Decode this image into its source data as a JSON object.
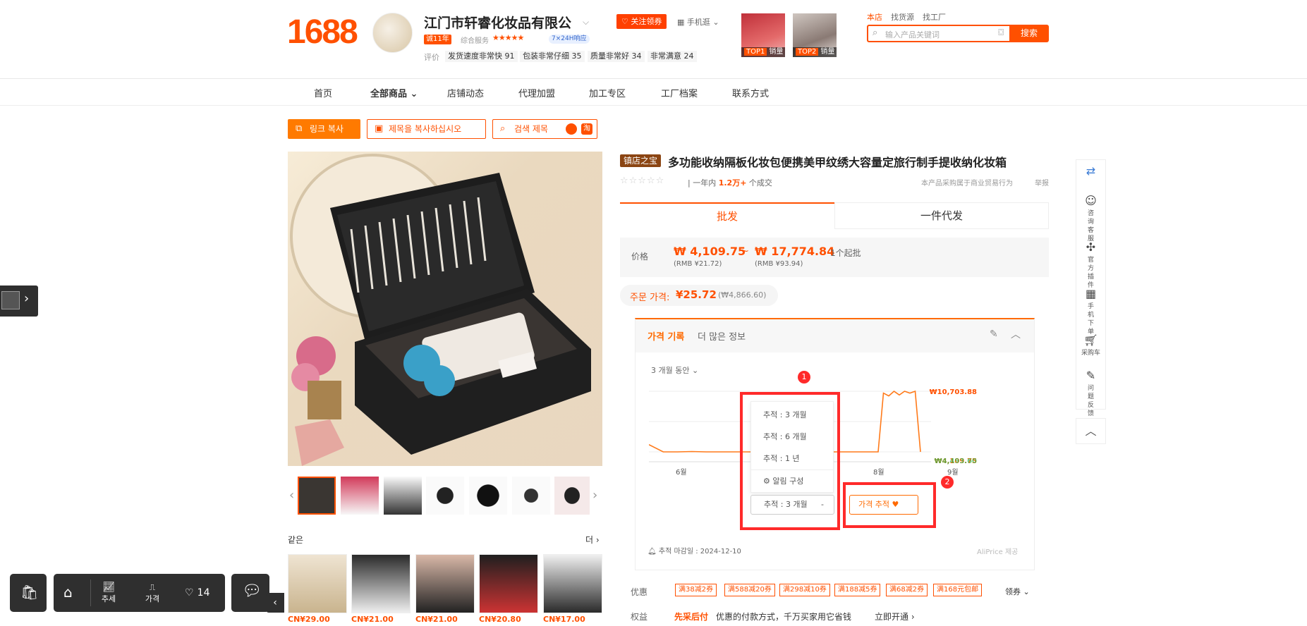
{
  "header": {
    "logo": "1688",
    "shop_name": "江门市轩睿化妆品有限公",
    "follow_label": "关注领券",
    "mobile_label": "手机逛",
    "years_badge": "诚11年",
    "service_label": "综合服务",
    "service_tag": "7×24H响应",
    "eval_label": "评价",
    "eval_items": [
      "发货速度非常快 91",
      "包装非常仔细 35",
      "质量非常好 34",
      "非常满意 24"
    ],
    "top_items": [
      {
        "rank": "TOP1",
        "label": "销量"
      },
      {
        "rank": "TOP2",
        "label": "销量"
      }
    ],
    "search_tabs": [
      "本店",
      "找货源",
      "找工厂"
    ],
    "search_placeholder": "输入产品关键词",
    "search_button": "搜索"
  },
  "nav": {
    "items": [
      "首页",
      "全部商品",
      "店铺动态",
      "代理加盟",
      "加工专区",
      "工厂档案",
      "联系方式"
    ]
  },
  "actions": {
    "copy_link": "링크 복사",
    "copy_title": "제목을 복사하십시오",
    "search_title": "검색 제목"
  },
  "gallery": {
    "same_label": "같은",
    "more_label": "더",
    "similar_prices": [
      "CN¥29.00",
      "CN¥21.00",
      "CN¥21.00",
      "CN¥20.80",
      "CN¥17.00"
    ]
  },
  "product": {
    "shop_tag": "镇店之宝",
    "title": "多功能收纳隔板化妆包便携美甲纹绣大容量定旅行制手提收纳化妆箱",
    "sales_prefix": "一年内",
    "sales_value": "1.2万+",
    "sales_suffix": "个成交",
    "notice": "本产品采购属于商业贸易行为",
    "report": "举报",
    "tab_wholesale": "批发",
    "tab_dropship": "一件代发",
    "price_label": "价格",
    "price_low": "₩ 4,109.75",
    "price_sep": "~",
    "price_high": "₩ 17,774.84",
    "moq": "1个起批",
    "rmb_low": "(RMB ¥21.72)",
    "rmb_high": "(RMB ¥93.94)",
    "order_label": "주문 가격:",
    "order_value": "¥25.72",
    "order_won": "(₩4,866.60)"
  },
  "tracker": {
    "tab_history": "가격 기록",
    "tab_more": "더 많은 정보",
    "period": "3 개월 동안",
    "menu_items": [
      "추적 : 3 개월",
      "추적 : 6 개월",
      "추적 : 1 년"
    ],
    "alert_config": "알림 구성",
    "selected": "추적 : 3 개월",
    "selected_suffix": "-",
    "track_button": "가격 추적",
    "deadline": "추적 마감일 : 2024-12-10",
    "powered": "AliPrice 제공",
    "callout_1": "1",
    "callout_2": "2",
    "accent_color": "#ff6a00",
    "highlight_color": "#ff2a2a"
  },
  "chart_data": {
    "type": "line",
    "x_ticks": [
      "6월",
      "8월",
      "9월"
    ],
    "max_label": "₩10,703.88",
    "current_label_a": "₩4,109.75",
    "current_label_b": "₩4,493.60",
    "series": [
      {
        "values": [
          4900,
          4109,
          4109,
          4150,
          4109,
          4109,
          4109,
          4109,
          4109,
          4109,
          4109,
          4109,
          4109,
          4109,
          4109,
          4109,
          4109,
          10500,
          10200,
          10703,
          10300,
          10703,
          10500,
          10703,
          4109
        ]
      }
    ]
  },
  "promo": {
    "label": "优惠",
    "coupons": [
      "满38减2券",
      "满588减20券",
      "满298减10券",
      "满188减5券",
      "满68减2券",
      "满168元包邮"
    ],
    "get_coupon": "领券",
    "rights_label": "权益",
    "rights_highlight": "先采后付",
    "rights_text": "优惠的付款方式，千万买家用它省钱",
    "rights_link": "立即开通"
  },
  "sidebar": {
    "items": [
      "咨询客服",
      "官方插件",
      "手机下单",
      "采购车",
      "问题反馈"
    ]
  },
  "bottom_bar": {
    "trend_label": "추세",
    "price_label": "가격",
    "likes": "14"
  }
}
